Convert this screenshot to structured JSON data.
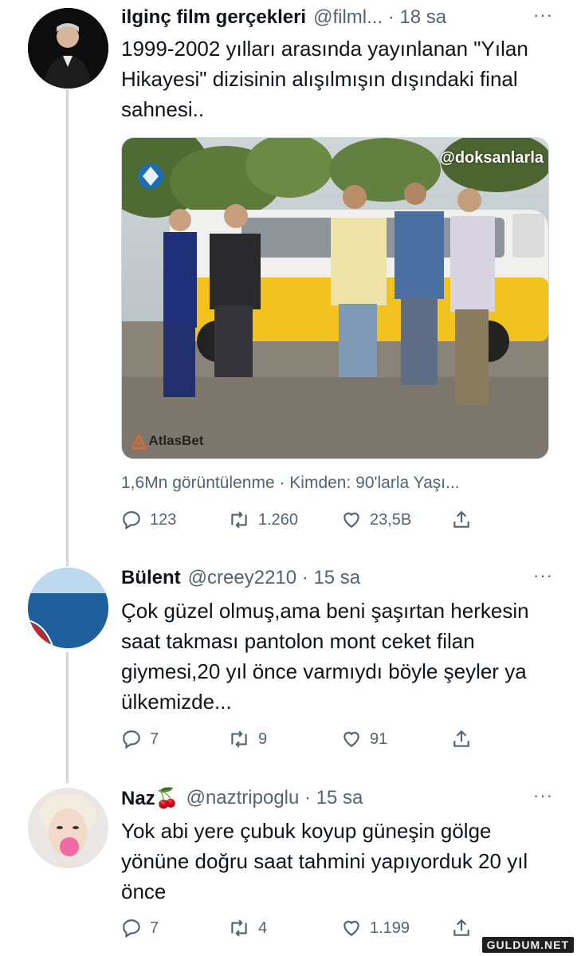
{
  "tweet1": {
    "name": "ilginç film gerçekleri",
    "handle": "@filml... · 18 sa",
    "more": "···",
    "text": "1999-2002 yılları arasında yayınlanan \"Yılan Hikayesi\" dizisinin alışılmışın dışındaki final sahnesi..",
    "media_watermark": "@doksanlarla",
    "media_sponsor": "AtlasBet",
    "media_caption": "1,6Mn görüntülenme · Kimden: 90'larla Yaşı...",
    "replies": "123",
    "retweets": "1.260",
    "likes": "23,5B"
  },
  "tweet2": {
    "name": "Bülent",
    "handle": "@creey2210 · 15 sa",
    "more": "···",
    "text": "Çok güzel olmuş,ama beni şaşırtan herkesin saat takması pantolon mont ceket filan giymesi,20 yıl önce varmıydı böyle şeyler ya ülkemizde...",
    "replies": "7",
    "retweets": "9",
    "likes": "91"
  },
  "tweet3": {
    "name": "Naz",
    "emoji": "🍒",
    "handle": "@naztripoglu · 15 sa",
    "more": "···",
    "text": "Yok abi yere çubuk koyup güneşin gölge yönüne doğru saat tahmini yapıyorduk 20 yıl önce",
    "replies": "7",
    "retweets": "4",
    "likes": "1.199"
  },
  "site_watermark": "GULDUM.NET",
  "colors": {
    "text": "#0f1419",
    "secondary": "#536471",
    "line": "#cfd9de"
  }
}
